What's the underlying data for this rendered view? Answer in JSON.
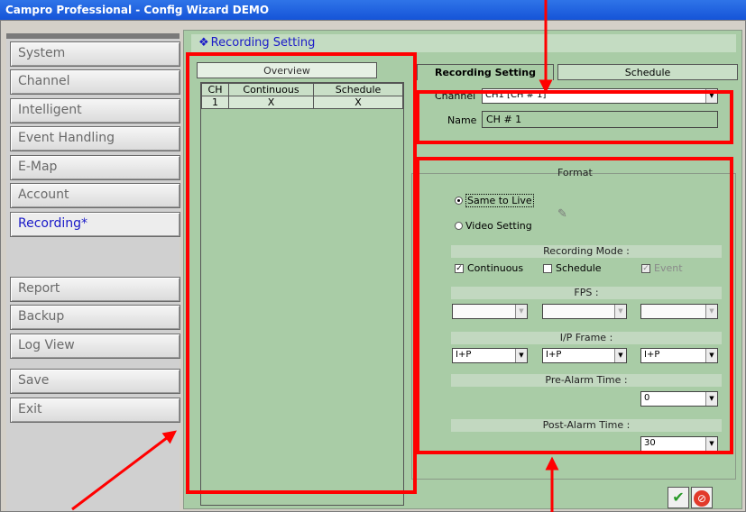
{
  "window": {
    "title": "Campro Professional - Config Wizard DEMO"
  },
  "sidebar": {
    "items": [
      {
        "label": "System"
      },
      {
        "label": "Channel"
      },
      {
        "label": "Intelligent"
      },
      {
        "label": "Event Handling"
      },
      {
        "label": "E-Map"
      },
      {
        "label": "Account"
      },
      {
        "label": "Recording*"
      },
      {
        "label": "Report"
      },
      {
        "label": "Backup"
      },
      {
        "label": "Log View"
      },
      {
        "label": "Save"
      },
      {
        "label": "Exit"
      }
    ]
  },
  "main": {
    "header_title": "Recording Setting",
    "overview": {
      "tab_label": "Overview",
      "columns": [
        "CH",
        "Continuous",
        "Schedule"
      ],
      "rows": [
        [
          "1",
          "X",
          "X"
        ]
      ]
    },
    "tabs": {
      "recording": "Recording Setting",
      "schedule": "Schedule"
    },
    "channel": {
      "label": "Channel",
      "value": "CH1 [CH # 1]"
    },
    "name": {
      "label": "Name",
      "value": "CH # 1"
    },
    "format": {
      "label": "Format",
      "same_to_live": "Same to Live",
      "video_setting": "Video Setting",
      "recording_mode_label": "Recording Mode :",
      "continuous": "Continuous",
      "schedule": "Schedule",
      "event": "Event",
      "fps_label": "FPS :",
      "fps_values": [
        "",
        "",
        ""
      ],
      "ip_frame_label": "I/P Frame :",
      "ip_frame_values": [
        "I+P",
        "I+P",
        "I+P"
      ],
      "pre_alarm_label": "Pre-Alarm Time :",
      "pre_alarm_value": "0",
      "post_alarm_label": "Post-Alarm Time :",
      "post_alarm_value": "30"
    }
  },
  "colors": {
    "highlight": "#ff0000",
    "panel_green": "#a9cca6",
    "active_nav": "#1818c8"
  }
}
